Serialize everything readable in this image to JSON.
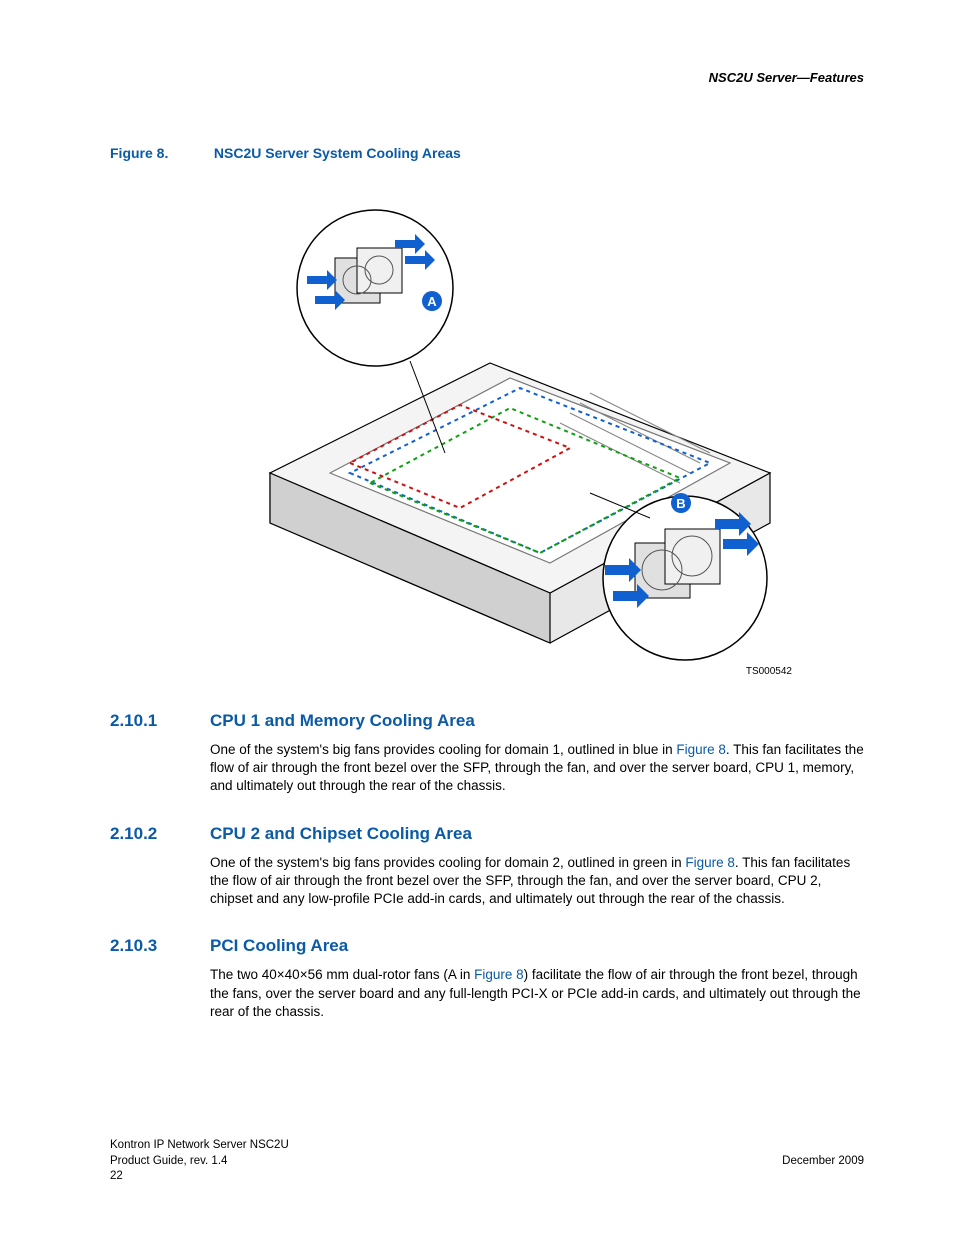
{
  "running_head": "NSC2U Server—Features",
  "figure": {
    "label": "Figure 8.",
    "title": "NSC2U Server System Cooling Areas",
    "image_id": "TS000542",
    "callout_a": "A",
    "callout_b": "B"
  },
  "sections": [
    {
      "num": "2.10.1",
      "title": "CPU 1 and Memory Cooling Area",
      "pre": "One of the system's big fans provides cooling for domain 1, outlined in blue in ",
      "link": "Figure 8",
      "post": ". This fan facilitates the flow of air through the front bezel over the SFP, through the fan, and over the server board, CPU 1, memory, and ultimately out through the rear of the chassis."
    },
    {
      "num": "2.10.2",
      "title": "CPU 2 and Chipset Cooling Area",
      "pre": "One of the system's big fans provides cooling for domain 2, outlined in green in ",
      "link": "Figure 8",
      "post": ". This fan facilitates the flow of air through the front bezel over the SFP, through the fan, and over the server board, CPU 2, chipset and any low-profile PCIe add-in cards, and ultimately out through the rear of the chassis."
    },
    {
      "num": "2.10.3",
      "title": "PCI Cooling Area",
      "pre": "The two 40×40×56 mm dual-rotor fans (A in ",
      "link": "Figure 8",
      "post": ") facilitate the flow of air through the front bezel, through the fans, over the server board and any full-length PCI-X or PCIe add-in cards, and ultimately out through the rear of the chassis."
    }
  ],
  "footer": {
    "left1": "Kontron IP Network Server NSC2U",
    "left2": "Product Guide, rev. 1.4",
    "right": "December 2009",
    "page": "22"
  }
}
